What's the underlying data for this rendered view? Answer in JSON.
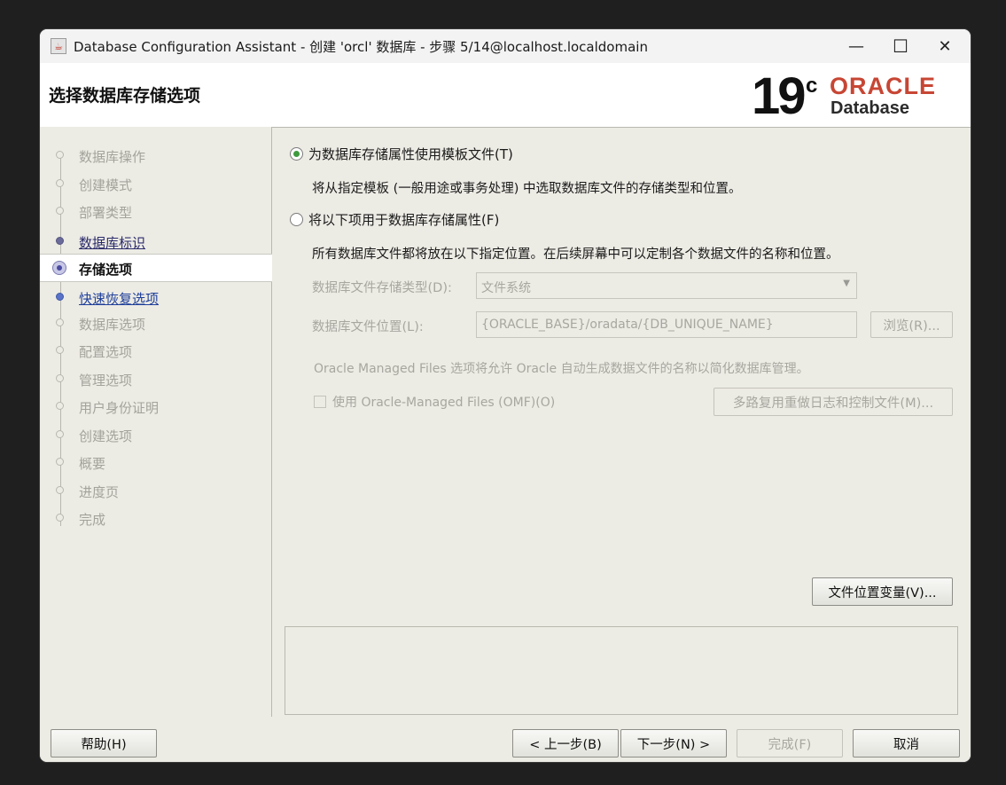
{
  "window": {
    "title": "Database Configuration Assistant - 创建 'orcl' 数据库 - 步骤 5/14@localhost.localdomain",
    "controls": {
      "minimize": "—",
      "maximize": "☐",
      "close": "✕"
    }
  },
  "header": {
    "title": "选择数据库存储选项",
    "brand": {
      "version": "19",
      "version_sup": "c",
      "oracle": "ORACLE",
      "product": "Database",
      "oracle_color": "#c74634"
    }
  },
  "steps": [
    {
      "label": "数据库操作",
      "state": "disabled"
    },
    {
      "label": "创建模式",
      "state": "disabled"
    },
    {
      "label": "部署类型",
      "state": "disabled"
    },
    {
      "label": "数据库标识",
      "state": "done"
    },
    {
      "label": "存储选项",
      "state": "current"
    },
    {
      "label": "快速恢复选项",
      "state": "next"
    },
    {
      "label": "数据库选项",
      "state": "disabled"
    },
    {
      "label": "配置选项",
      "state": "disabled"
    },
    {
      "label": "管理选项",
      "state": "disabled"
    },
    {
      "label": "用户身份证明",
      "state": "disabled"
    },
    {
      "label": "创建选项",
      "state": "disabled"
    },
    {
      "label": "概要",
      "state": "disabled"
    },
    {
      "label": "进度页",
      "state": "disabled"
    },
    {
      "label": "完成",
      "state": "disabled"
    }
  ],
  "options": {
    "use_template": {
      "label": "为数据库存储属性使用模板文件(T)",
      "selected": true,
      "description": "将从指定模板 (一般用途或事务处理) 中选取数据库文件的存储类型和位置。"
    },
    "use_following": {
      "label": "将以下项用于数据库存储属性(F)",
      "selected": false,
      "description": "所有数据库文件都将放在以下指定位置。在后续屏幕中可以定制各个数据文件的名称和位置。"
    }
  },
  "storage": {
    "type_label": "数据库文件存储类型(D):",
    "type_value": "文件系统",
    "location_label": "数据库文件位置(L):",
    "location_value": "{ORACLE_BASE}/oradata/{DB_UNIQUE_NAME}",
    "browse_button": "浏览(R)...",
    "omf_note": "Oracle Managed Files 选项将允许 Oracle 自动生成数据文件的名称以简化数据库管理。",
    "omf_checkbox": "使用 Oracle-Managed Files (OMF)(O)",
    "multiplex_button": "多路复用重做日志和控制文件(M)...",
    "file_location_button": "文件位置变量(V)..."
  },
  "footer": {
    "help": "帮助(H)",
    "back": "< 上一步(B)",
    "next": "下一步(N) >",
    "finish": "完成(F)",
    "cancel": "取消"
  }
}
